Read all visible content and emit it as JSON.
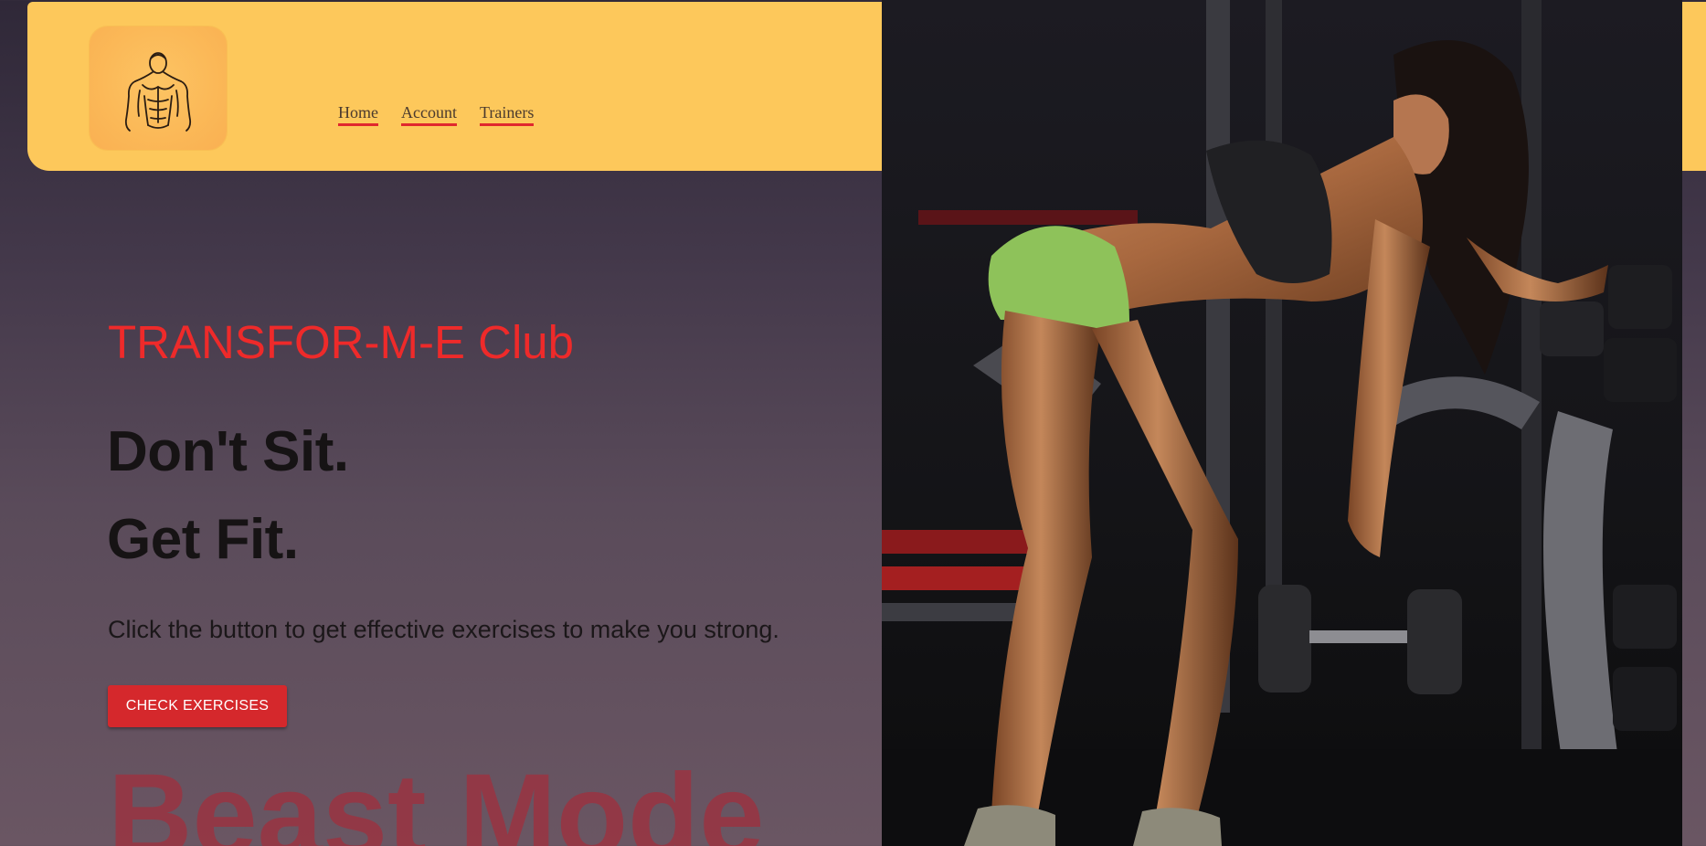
{
  "header": {
    "logo_icon": "muscular-man-icon",
    "nav": [
      {
        "label": "Home"
      },
      {
        "label": "Account"
      },
      {
        "label": "Trainers"
      }
    ]
  },
  "hero": {
    "club_name": "TRANSFOR-M-E Club",
    "headline_line1": "Don't Sit.",
    "headline_line2": "Get Fit.",
    "tagline": "Click the button to get effective exercises to make you strong.",
    "cta_label": "CHECK EXERCISES",
    "background_text": "Beast Mode"
  },
  "photo": {
    "subject": "woman-lifting-dumbbell-photo"
  },
  "colors": {
    "header_bg": "#fdc85b",
    "accent_red": "#ee2a2a",
    "button_red": "#d5282c",
    "nav_underline": "#e0282e"
  }
}
